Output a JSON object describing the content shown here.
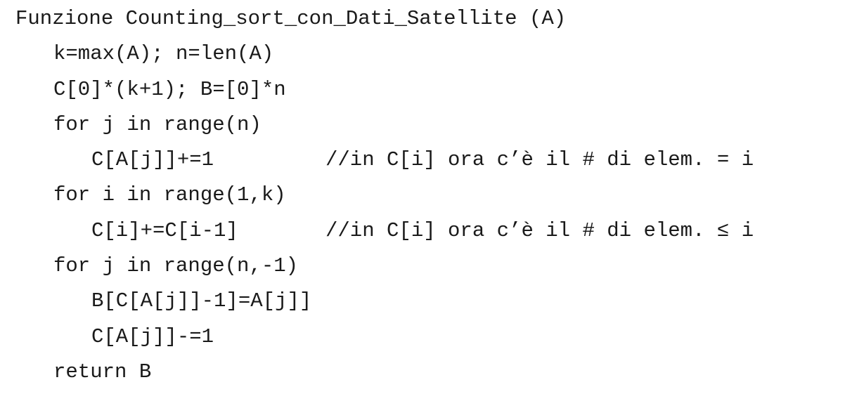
{
  "code": {
    "header": "Funzione Counting_sort_con_Dati_Satellite (A)",
    "lines": [
      {
        "stmt": "k=max(A); n=len(A)",
        "comment": ""
      },
      {
        "stmt": "C[0]*(k+1); B=[0]*n",
        "comment": ""
      },
      {
        "stmt": "for j in range(n)",
        "comment": ""
      },
      {
        "stmt": "C[A[j]]+=1",
        "comment": "//in C[i] ora c’è il # di elem. = i"
      },
      {
        "stmt": "for i in range(1,k)",
        "comment": ""
      },
      {
        "stmt": "C[i]+=C[i-1]",
        "comment": "//in C[i] ora c’è il # di elem. ≤ i"
      },
      {
        "stmt": "for j in range(n,-1)",
        "comment": ""
      },
      {
        "stmt": "B[C[A[j]]-1]=A[j]]",
        "comment": ""
      },
      {
        "stmt": "C[A[j]]-=1",
        "comment": ""
      },
      {
        "stmt": "return B",
        "comment": ""
      }
    ]
  }
}
